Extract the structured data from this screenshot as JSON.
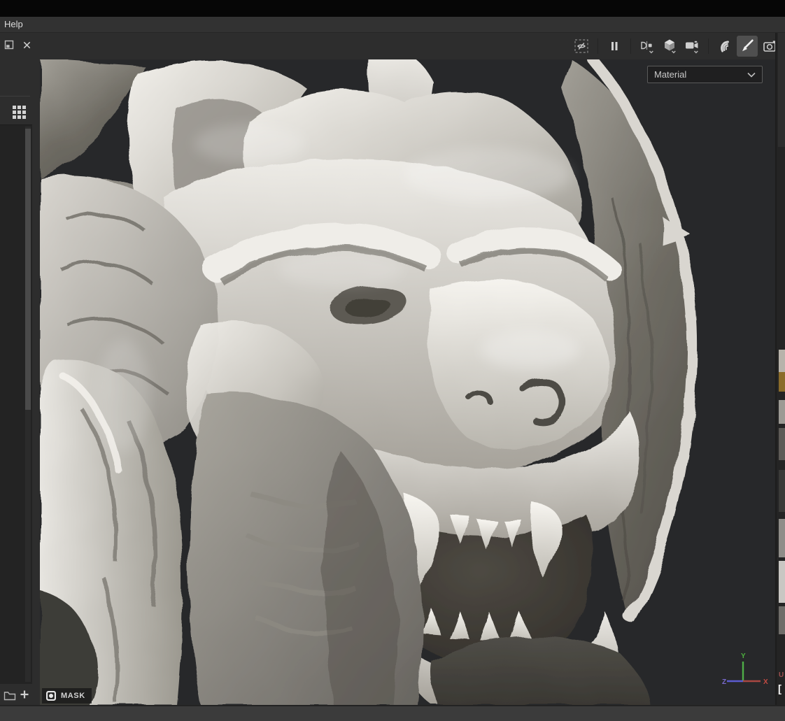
{
  "window": {
    "menu": {
      "help_label": "Help"
    }
  },
  "left_dock": {
    "panel_controls": {
      "float_icon": "float-panel-icon",
      "close_icon": "close-icon"
    },
    "layers_panel": {
      "grid_icon": "grid-view-icon",
      "scrollbar": "vertical",
      "add_folder_icon": "add-folder-icon",
      "add_layer_icon": "add-layer-icon"
    }
  },
  "toolbar": {
    "icons": [
      {
        "name": "isolate-selection-toggle",
        "state": "off"
      },
      {
        "name": "pause-engine-button",
        "state": "off"
      },
      {
        "name": "view-layout-dropdown",
        "state": "off"
      },
      {
        "name": "camera-projection-dropdown",
        "state": "off"
      },
      {
        "name": "camera-dropdown",
        "state": "off"
      },
      {
        "name": "particles-tool",
        "state": "off"
      },
      {
        "name": "paint-brush-tool",
        "state": "active"
      },
      {
        "name": "camera-capture-tool",
        "state": "off"
      }
    ]
  },
  "viewport": {
    "shading_dropdown": {
      "value": "Material"
    },
    "mask_badge": {
      "label": "MASK"
    },
    "axis_gizmo": {
      "x_label": "X",
      "y_label": "Y",
      "z_label": "Z"
    },
    "right_edge": {
      "u_axis_label": "U",
      "bracket": "["
    },
    "content": "3D render of a white marble gargoyle statue, horned head with open fanged mouth, folded wing on right, muscular foreleg lower left"
  },
  "colors": {
    "axis_x": "#c24a42",
    "axis_y": "#4cb03e",
    "axis_z": "#7a6acd",
    "u_label": "#9c4f4f",
    "toolbar_bg": "#2d2d2d",
    "viewport_bg": "#27282a",
    "bottom_bar_bg": "#3b3b3b",
    "active_tool_bg": "#4f4f4f"
  }
}
